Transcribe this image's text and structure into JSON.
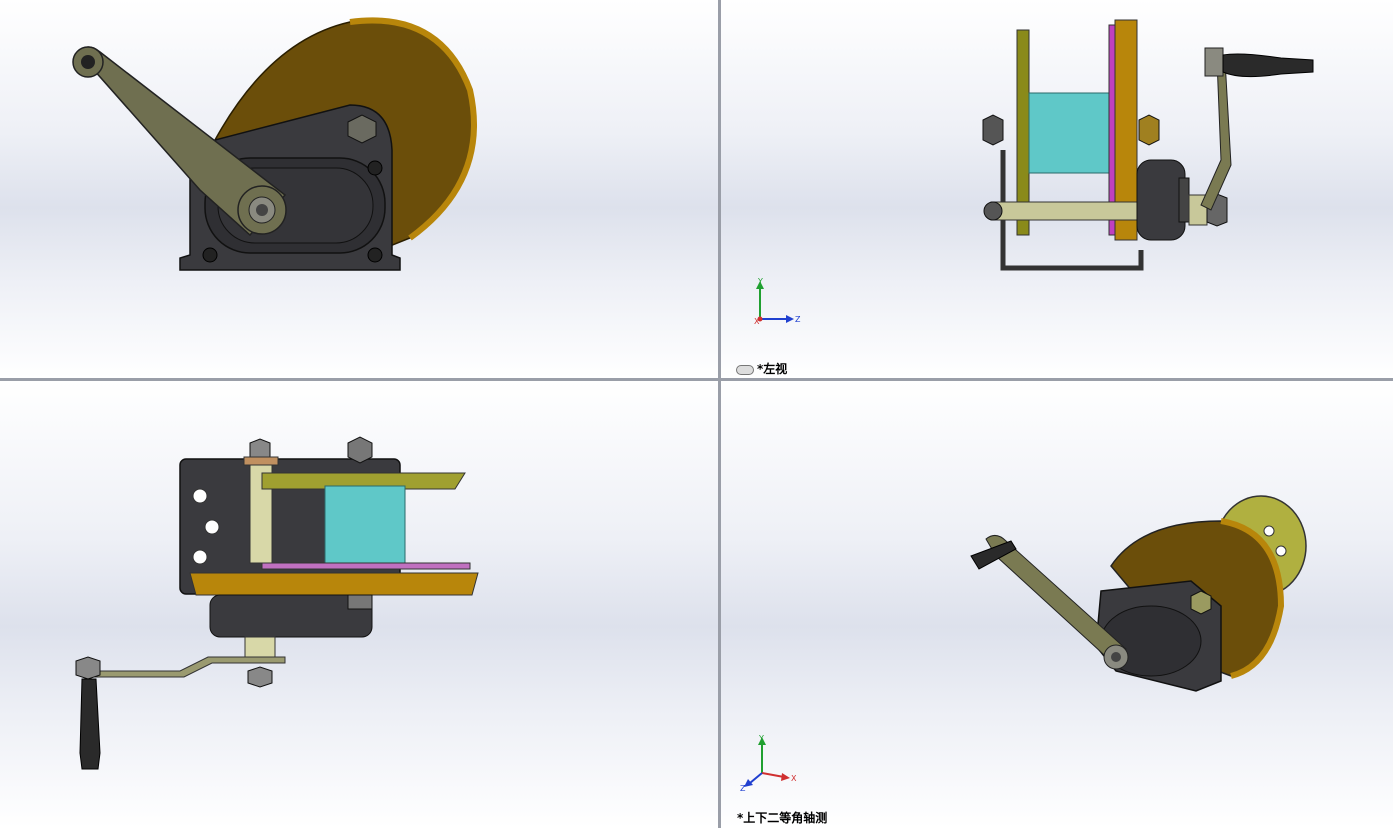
{
  "views": {
    "top_left": {
      "label": ""
    },
    "top_right": {
      "label": "*左视"
    },
    "bottom_left": {
      "label": ""
    },
    "bottom_right": {
      "label": "*上下二等角轴测"
    }
  },
  "triad": {
    "x": "X",
    "y": "Y",
    "z": "Z"
  },
  "colors": {
    "drum_flange": "#b8860b",
    "drum_core": "#5fc8c8",
    "housing": "#3a3a3e",
    "crank_arm": "#7a7a52",
    "axis_x": "#d03030",
    "axis_y": "#20a030",
    "axis_z": "#2040d0"
  },
  "icons": [
    "link-icon",
    "coordinate-triad-icon"
  ]
}
